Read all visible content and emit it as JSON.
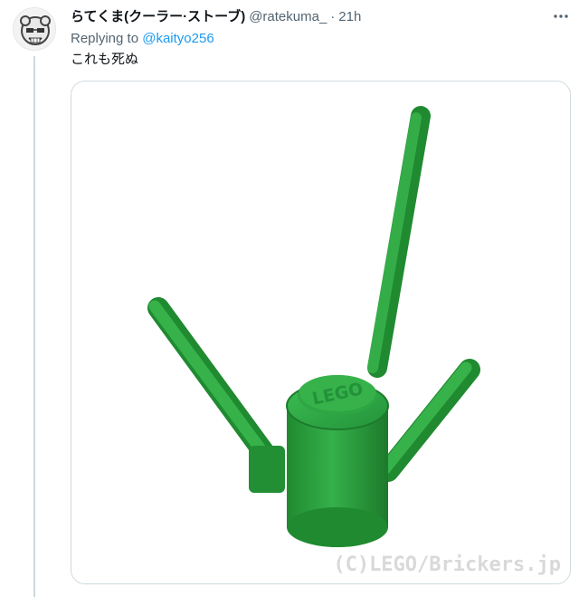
{
  "tweet": {
    "display_name": "らてくま(クーラー·ストーブ)",
    "handle": "@ratekuma_",
    "separator": "·",
    "time": "21h",
    "more_icon": "more-horizontal-icon",
    "replying_prefix": "Replying to",
    "replying_to": "@kaityo256",
    "text": "これも死ぬ",
    "media": {
      "subject": "green-lego-antenna-piece",
      "stud_text": "LEGO",
      "watermark": "(C)LEGO/Brickers.jp"
    }
  },
  "colors": {
    "link": "#1d9bf0",
    "muted": "#536471",
    "thread_line": "#cfd9de",
    "lego_green": "#2a9d3a"
  }
}
